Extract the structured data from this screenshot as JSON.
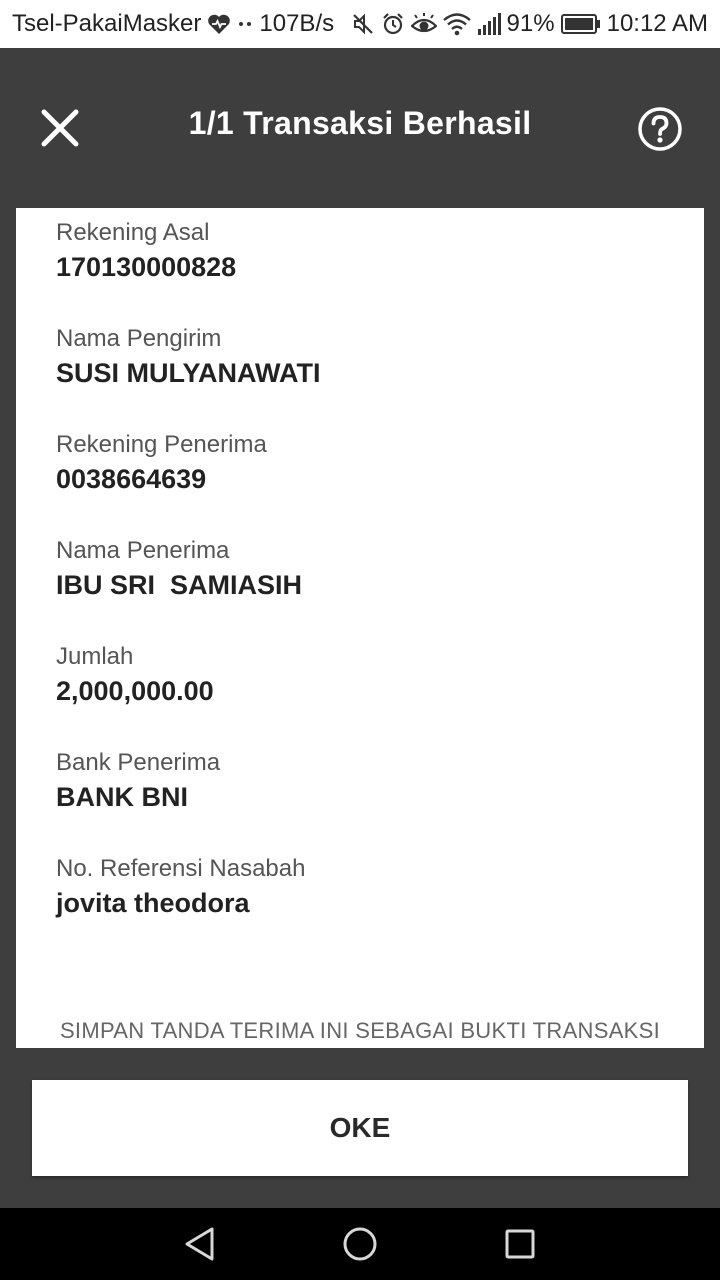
{
  "status_bar": {
    "carrier": "Tsel-PakaiMasker",
    "net_speed": "107B/s",
    "battery": "91%",
    "time": "10:12 AM",
    "icons": [
      "heart-icon",
      "dots-icon",
      "mute-icon",
      "alarm-icon",
      "eye-icon",
      "wifi-icon",
      "signal-icon",
      "battery-icon"
    ]
  },
  "header": {
    "title": "1/1 Transaksi Berhasil",
    "close_icon": "close-icon",
    "help_icon": "help-icon"
  },
  "receipt": {
    "fields": [
      {
        "label": "Rekening Asal",
        "value": "170130000828"
      },
      {
        "label": "Nama Pengirim",
        "value": "SUSI MULYANAWATI"
      },
      {
        "label": "Rekening Penerima",
        "value": "0038664639"
      },
      {
        "label": "Nama Penerima",
        "value": "IBU SRI  SAMIASIH"
      },
      {
        "label": "Jumlah",
        "value": "2,000,000.00"
      },
      {
        "label": "Bank Penerima",
        "value": "BANK BNI"
      },
      {
        "label": "No. Referensi Nasabah",
        "value": "jovita theodora"
      }
    ],
    "footer_note": "SIMPAN TANDA TERIMA INI SEBAGAI BUKTI TRANSAKSI"
  },
  "actions": {
    "ok_label": "OKE"
  },
  "nav_bar": {
    "icons": [
      "back-icon",
      "home-icon",
      "recents-icon"
    ]
  },
  "colors": {
    "header_bg": "#3e3e3e",
    "card_bg": "#ffffff",
    "nav_bg": "#000000"
  }
}
